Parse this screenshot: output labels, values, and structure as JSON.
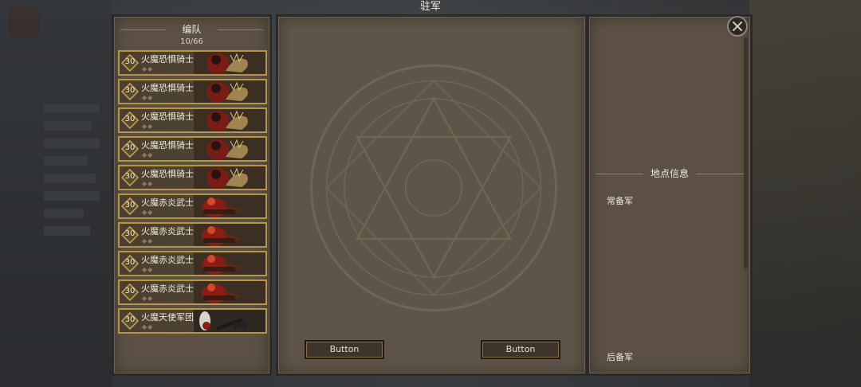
{
  "window": {
    "title": "驻军"
  },
  "formation": {
    "header": "编队",
    "count": "10/66",
    "units": [
      {
        "level": "30",
        "name": "火魔恐惧骑士",
        "type": "knight"
      },
      {
        "level": "30",
        "name": "火魔恐惧骑士",
        "type": "knight"
      },
      {
        "level": "30",
        "name": "火魔恐惧骑士",
        "type": "knight"
      },
      {
        "level": "30",
        "name": "火魔恐惧骑士",
        "type": "knight"
      },
      {
        "level": "30",
        "name": "火魔恐惧骑士",
        "type": "knight"
      },
      {
        "level": "30",
        "name": "火魔赤炎武士",
        "type": "warrior"
      },
      {
        "level": "30",
        "name": "火魔赤炎武士",
        "type": "warrior"
      },
      {
        "level": "30",
        "name": "火魔赤炎武士",
        "type": "warrior"
      },
      {
        "level": "30",
        "name": "火魔赤炎武士",
        "type": "warrior"
      },
      {
        "level": "30",
        "name": "火魔天使军团",
        "type": "angel"
      }
    ]
  },
  "center": {
    "left_button": "Button",
    "right_button": "Button"
  },
  "location": {
    "header": "地点信息",
    "regular_reserve": "常备军",
    "rear_reserve": "后备军"
  },
  "colors": {
    "unit_border": "#b59645",
    "panel_bg": "#5b5043",
    "button_bg": "#3f3429"
  }
}
